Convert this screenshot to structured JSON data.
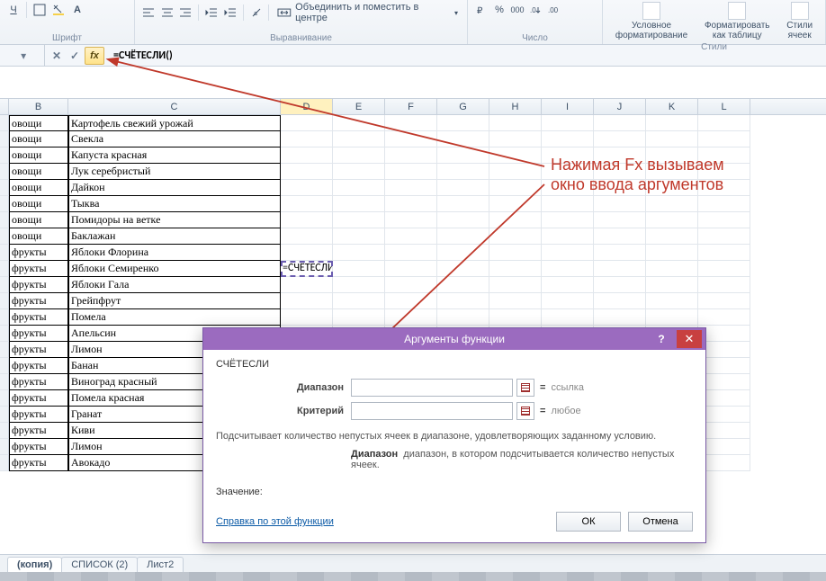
{
  "ribbon": {
    "merge_label": "Объединить и поместить в центре",
    "number_group": "Число",
    "align_group": "Выравнивание",
    "font_group": "Шрифт",
    "styles_group": "Стили",
    "cond_fmt": "Условное\nформатирование",
    "as_table": "Форматировать\nкак таблицу",
    "cell_styles": "Стили\nячеек",
    "currency": "%",
    "thousand": "000"
  },
  "formula_bar": {
    "cancel": "✕",
    "accept": "✓",
    "fx": "fx",
    "formula": "=СЧЁТЕСЛИ()"
  },
  "columns": [
    "B",
    "C",
    "D",
    "E",
    "F",
    "G",
    "H",
    "I",
    "J",
    "K",
    "L"
  ],
  "active_column": "D",
  "rows": [
    {
      "b": "овощи",
      "c": "Картофель свежий урожай"
    },
    {
      "b": "овощи",
      "c": "Свекла"
    },
    {
      "b": "овощи",
      "c": "Капуста красная"
    },
    {
      "b": "овощи",
      "c": "Лук серебристый"
    },
    {
      "b": "овощи",
      "c": "Дайкон"
    },
    {
      "b": "овощи",
      "c": "Тыква"
    },
    {
      "b": "овощи",
      "c": "Помидоры на ветке"
    },
    {
      "b": "овощи",
      "c": "Баклажан"
    },
    {
      "b": "фрукты",
      "c": "Яблоки Флорина"
    },
    {
      "b": "фрукты",
      "c": "Яблоки Семиренко",
      "d": "=СЧЁТЕСЛИ()",
      "active": true
    },
    {
      "b": "фрукты",
      "c": "Яблоки Гала"
    },
    {
      "b": "фрукты",
      "c": "Грейпфрут"
    },
    {
      "b": "фрукты",
      "c": "Помела"
    },
    {
      "b": "фрукты",
      "c": "Апельсин"
    },
    {
      "b": "фрукты",
      "c": "Лимон"
    },
    {
      "b": "фрукты",
      "c": "Банан"
    },
    {
      "b": "фрукты",
      "c": "Виноград  красный"
    },
    {
      "b": "фрукты",
      "c": "Помела красная"
    },
    {
      "b": "фрукты",
      "c": "Гранат"
    },
    {
      "b": "фрукты",
      "c": "Киви"
    },
    {
      "b": "фрукты",
      "c": "Лимон"
    },
    {
      "b": "фрукты",
      "c": "Авокадо"
    }
  ],
  "sheets": {
    "tabs": [
      "(копия)",
      "СПИСОК (2)",
      "Лист2"
    ],
    "active": 0
  },
  "annotation": {
    "line1": "Нажимая Fx вызываем",
    "line2": "окно ввода аргументов"
  },
  "dialog": {
    "title": "Аргументы функции",
    "fn": "СЧЁТЕСЛИ",
    "range_lbl": "Диапазон",
    "crit_lbl": "Критерий",
    "range_hint": "ссылка",
    "crit_hint": "любое",
    "desc": "Подсчитывает количество непустых ячеек в диапазоне, удовлетворяющих заданному условию.",
    "desc2_label": "Диапазон",
    "desc2_text": "диапазон, в котором подсчитывается количество непустых ячеек.",
    "value_lbl": "Значение:",
    "help": "Справка по этой функции",
    "ok": "ОК",
    "cancel": "Отмена"
  }
}
